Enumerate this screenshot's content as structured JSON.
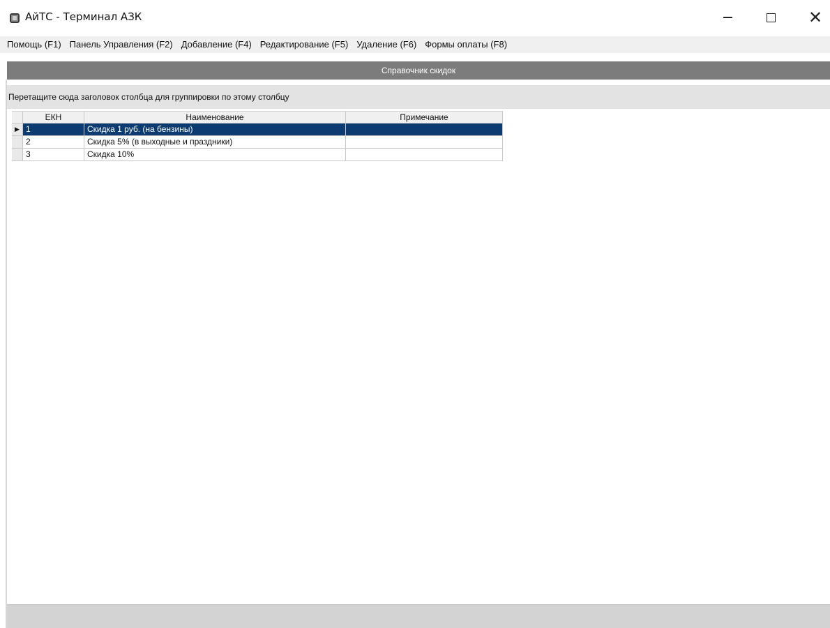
{
  "window": {
    "title": "АйТС - Терминал АЗК"
  },
  "menu": [
    {
      "label": "Помощь (F1)"
    },
    {
      "label": "Панель Управления (F2)"
    },
    {
      "label": "Добавление (F4)"
    },
    {
      "label": "Редактирование (F5)"
    },
    {
      "label": "Удаление (F6)"
    },
    {
      "label": "Формы оплаты (F8)"
    }
  ],
  "header": {
    "title": "Справочник скидок"
  },
  "group_panel": {
    "hint": "Перетащите сюда заголовок столбца для группировки по этому столбцу"
  },
  "grid": {
    "columns": [
      {
        "label": "ЕКН"
      },
      {
        "label": "Наименование"
      },
      {
        "label": "Примечание"
      }
    ],
    "rows": [
      {
        "ekh": "1",
        "name": "Скидка 1 руб. (на бензины)",
        "note": "",
        "selected": true
      },
      {
        "ekh": "2",
        "name": "Скидка 5% (в выходные и праздники)",
        "note": "",
        "selected": false
      },
      {
        "ekh": "3",
        "name": "Скидка 10%",
        "note": "",
        "selected": false
      }
    ]
  },
  "colors": {
    "selection": "#0b3b70",
    "header_strip": "#7c7c7c",
    "group_panel": "#e3e3e3"
  },
  "icons": {
    "app": "terminal-app-icon",
    "row_indicator": "triangle-right"
  }
}
